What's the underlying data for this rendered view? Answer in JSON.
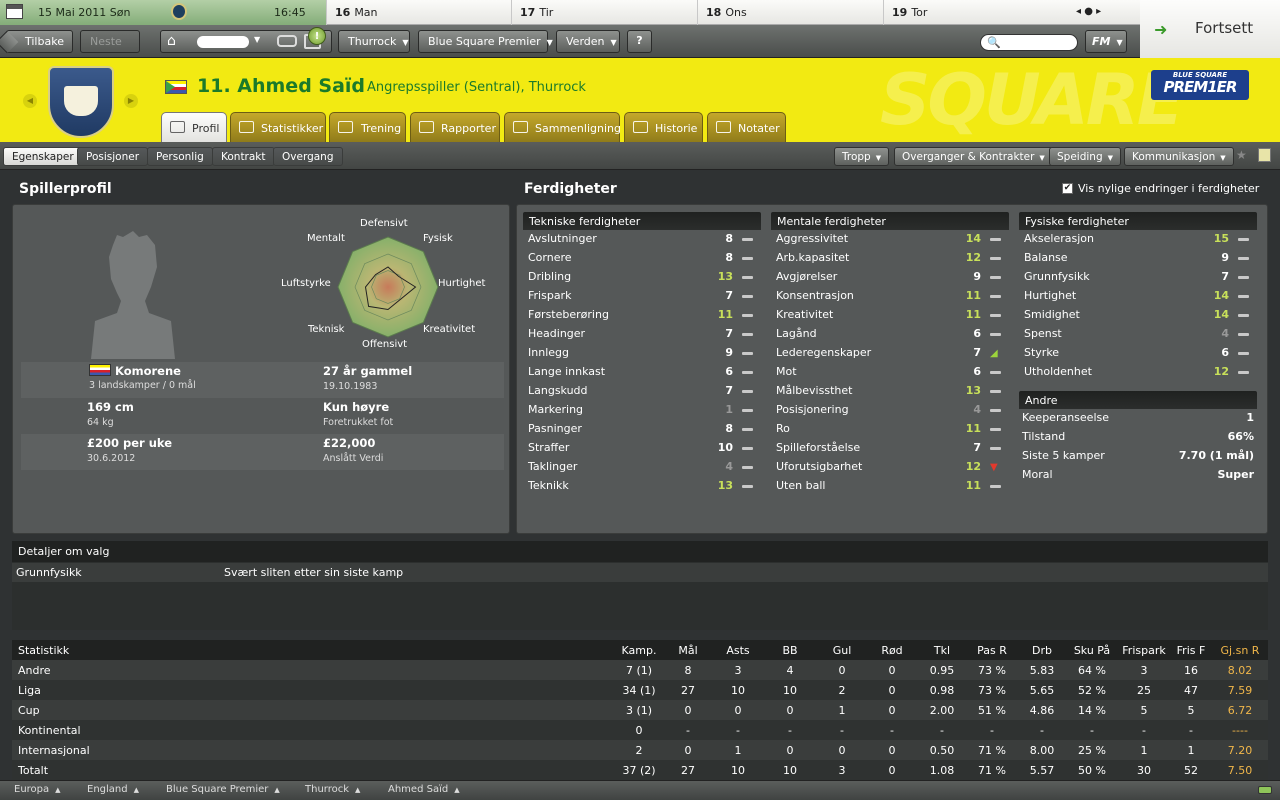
{
  "topbar": {
    "date": "15 Mai 2011 Søn",
    "time": "16:45",
    "days": [
      {
        "num": "16",
        "name": "Man"
      },
      {
        "num": "17",
        "name": "Tir"
      },
      {
        "num": "18",
        "name": "Ons"
      },
      {
        "num": "19",
        "name": "Tor"
      }
    ],
    "nav_glyphs": "◂  ●  ▸",
    "continue_label": "Fortsett"
  },
  "navbar": {
    "back": "Tilbake",
    "next": "Neste",
    "news_count": "!",
    "club": "Thurrock",
    "league": "Blue Square Premier",
    "world": "Verden",
    "help": "?",
    "search_placeholder": "",
    "fm": "FM"
  },
  "header": {
    "title": "11. Ahmed Saïd",
    "subtitle": "Angrepsspiller (Sentral), Thurrock",
    "league_logo_top": "BLUE SQUARE",
    "league_logo_main": "PREM1ER",
    "tabs": [
      "Profil",
      "Statistikker",
      "Trening",
      "Rapporter",
      "Sammenligning",
      "Historie",
      "Notater"
    ]
  },
  "subtabs": [
    "Egenskaper",
    "Posisjoner",
    "Personlig",
    "Kontrakt",
    "Overgang"
  ],
  "actions": [
    "Tropp",
    "Overganger & Kontrakter",
    "Speiding",
    "Kommunikasjon"
  ],
  "profile": {
    "title": "Spillerprofil",
    "radar_labels": {
      "defensive": "Defensivt",
      "physical": "Fysisk",
      "speed": "Hurtighet",
      "creativity": "Kreativitet",
      "offensive": "Offensivt",
      "technical": "Teknisk",
      "aerial": "Luftstyrke",
      "mental": "Mentalt"
    },
    "radar_values": [
      0.4,
      0.3,
      0.55,
      0.35,
      0.45,
      0.55,
      0.45,
      0.35
    ],
    "nation": "Komorene",
    "caps": "3 landskamper / 0 mål",
    "age": "27 år gammel",
    "dob": "19.10.1983",
    "height": "169 cm",
    "weight": "64 kg",
    "foot": "Kun høyre",
    "foot_label": "Foretrukket fot",
    "wage": "£200 per uke",
    "contract_end": "30.6.2012",
    "value": "£22,000",
    "value_label": "Anslått Verdi"
  },
  "skills": {
    "title": "Ferdigheter",
    "show_changes_label": "Vis nylige endringer i ferdigheter",
    "technical_title": "Tekniske ferdigheter",
    "technical": [
      {
        "name": "Avslutninger",
        "value": "8",
        "cls": "",
        "chg": "flat"
      },
      {
        "name": "Cornere",
        "value": "8",
        "cls": "",
        "chg": "flat"
      },
      {
        "name": "Dribling",
        "value": "13",
        "cls": "hi",
        "chg": "flat"
      },
      {
        "name": "Frispark",
        "value": "7",
        "cls": "",
        "chg": "flat"
      },
      {
        "name": "Førsteberøring",
        "value": "11",
        "cls": "hi",
        "chg": "flat"
      },
      {
        "name": "Headinger",
        "value": "7",
        "cls": "",
        "chg": "flat"
      },
      {
        "name": "Innlegg",
        "value": "9",
        "cls": "",
        "chg": "flat"
      },
      {
        "name": "Lange innkast",
        "value": "6",
        "cls": "",
        "chg": "flat"
      },
      {
        "name": "Langskudd",
        "value": "7",
        "cls": "",
        "chg": "flat"
      },
      {
        "name": "Markering",
        "value": "1",
        "cls": "lo",
        "chg": "flat"
      },
      {
        "name": "Pasninger",
        "value": "8",
        "cls": "",
        "chg": "flat"
      },
      {
        "name": "Straffer",
        "value": "10",
        "cls": "",
        "chg": "flat"
      },
      {
        "name": "Taklinger",
        "value": "4",
        "cls": "lo",
        "chg": "flat"
      },
      {
        "name": "Teknikk",
        "value": "13",
        "cls": "hi",
        "chg": "flat"
      }
    ],
    "mental_title": "Mentale ferdigheter",
    "mental": [
      {
        "name": "Aggressivitet",
        "value": "14",
        "cls": "hi",
        "chg": "flat"
      },
      {
        "name": "Arb.kapasitet",
        "value": "12",
        "cls": "hi",
        "chg": "flat"
      },
      {
        "name": "Avgjørelser",
        "value": "9",
        "cls": "",
        "chg": "flat"
      },
      {
        "name": "Konsentrasjon",
        "value": "11",
        "cls": "hi",
        "chg": "flat"
      },
      {
        "name": "Kreativitet",
        "value": "11",
        "cls": "hi",
        "chg": "flat"
      },
      {
        "name": "Lagånd",
        "value": "6",
        "cls": "",
        "chg": "flat"
      },
      {
        "name": "Lederegenskaper",
        "value": "7",
        "cls": "",
        "chg": "up"
      },
      {
        "name": "Mot",
        "value": "6",
        "cls": "",
        "chg": "flat"
      },
      {
        "name": "Målbevissthet",
        "value": "13",
        "cls": "hi",
        "chg": "flat"
      },
      {
        "name": "Posisjonering",
        "value": "4",
        "cls": "lo",
        "chg": "flat"
      },
      {
        "name": "Ro",
        "value": "11",
        "cls": "hi",
        "chg": "flat"
      },
      {
        "name": "Spilleforståelse",
        "value": "7",
        "cls": "",
        "chg": "flat"
      },
      {
        "name": "Uforutsigbarhet",
        "value": "12",
        "cls": "hi",
        "chg": "down"
      },
      {
        "name": "Uten ball",
        "value": "11",
        "cls": "hi",
        "chg": "flat"
      }
    ],
    "physical_title": "Fysiske ferdigheter",
    "physical": [
      {
        "name": "Akselerasjon",
        "value": "15",
        "cls": "hi",
        "chg": "flat"
      },
      {
        "name": "Balanse",
        "value": "9",
        "cls": "",
        "chg": "flat"
      },
      {
        "name": "Grunnfysikk",
        "value": "7",
        "cls": "",
        "chg": "flat"
      },
      {
        "name": "Hurtighet",
        "value": "14",
        "cls": "hi",
        "chg": "flat"
      },
      {
        "name": "Smidighet",
        "value": "14",
        "cls": "hi",
        "chg": "flat"
      },
      {
        "name": "Spenst",
        "value": "4",
        "cls": "lo",
        "chg": "flat"
      },
      {
        "name": "Styrke",
        "value": "6",
        "cls": "",
        "chg": "flat"
      },
      {
        "name": "Utholdenhet",
        "value": "12",
        "cls": "hi",
        "chg": "flat"
      }
    ],
    "other_title": "Andre",
    "other": [
      {
        "name": "Keeperanseelse",
        "value": "1"
      },
      {
        "name": "Tilstand",
        "value": "66%"
      },
      {
        "name": "Siste 5 kamper",
        "value": "7.70 (1 mål)"
      },
      {
        "name": "Moral",
        "value": "Super"
      }
    ]
  },
  "details": {
    "title": "Detaljer om valg",
    "key": "Grunnfysikk",
    "value": "Svært sliten etter sin siste kamp"
  },
  "stats": {
    "headers": [
      "Statistikk",
      "Kamp.",
      "Mål",
      "Asts",
      "BB",
      "Gul",
      "Rød",
      "Tkl",
      "Pas R",
      "Drb",
      "Sku På",
      "Frispark",
      "Fris F",
      "Gj.sn R"
    ],
    "rows": [
      [
        "Andre",
        "7 (1)",
        "8",
        "3",
        "4",
        "0",
        "0",
        "0.95",
        "73 %",
        "5.83",
        "64 %",
        "3",
        "16",
        "8.02"
      ],
      [
        "Liga",
        "34 (1)",
        "27",
        "10",
        "10",
        "2",
        "0",
        "0.98",
        "73 %",
        "5.65",
        "52 %",
        "25",
        "47",
        "7.59"
      ],
      [
        "Cup",
        "3 (1)",
        "0",
        "0",
        "0",
        "1",
        "0",
        "2.00",
        "51 %",
        "4.86",
        "14 %",
        "5",
        "5",
        "6.72"
      ],
      [
        "Kontinental",
        "0",
        "-",
        "-",
        "-",
        "-",
        "-",
        "-",
        "-",
        "-",
        "-",
        "-",
        "-",
        "----"
      ],
      [
        "Internasjonal",
        "2",
        "0",
        "1",
        "0",
        "0",
        "0",
        "0.50",
        "71 %",
        "8.00",
        "25 %",
        "1",
        "1",
        "7.20"
      ],
      [
        "Totalt",
        "37 (2)",
        "27",
        "10",
        "10",
        "3",
        "0",
        "1.08",
        "71 %",
        "5.57",
        "50 %",
        "30",
        "52",
        "7.50"
      ]
    ]
  },
  "breadcrumb": [
    "Europa",
    "England",
    "Blue Square Premier",
    "Thurrock",
    "Ahmed Saïd"
  ]
}
